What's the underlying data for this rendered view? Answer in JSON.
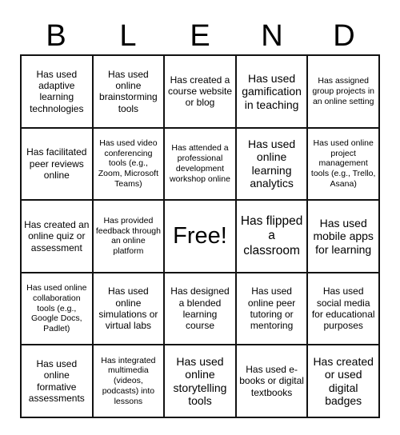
{
  "card": {
    "title_letters": [
      "B",
      "L",
      "E",
      "N",
      "D"
    ],
    "free_space_label": "Free!",
    "border_color": "#111111",
    "background_color": "#ffffff",
    "text_color": "#000000"
  },
  "grid": {
    "columns": 5,
    "rows": 5,
    "cells": [
      {
        "id": "b1",
        "text": "Has used adaptive learning technologies"
      },
      {
        "id": "l1",
        "text": "Has used online brainstorming tools"
      },
      {
        "id": "e1",
        "text": "Has created a course website or blog"
      },
      {
        "id": "n1",
        "text": "Has used gamification in teaching"
      },
      {
        "id": "d1",
        "text": "Has assigned group projects in an online setting"
      },
      {
        "id": "b2",
        "text": "Has facilitated peer reviews online"
      },
      {
        "id": "l2",
        "text": "Has used video conferencing tools (e.g., Zoom, Microsoft Teams)"
      },
      {
        "id": "e2",
        "text": "Has attended a professional development workshop online"
      },
      {
        "id": "n2",
        "text": "Has used online learning analytics"
      },
      {
        "id": "d2",
        "text": "Has used online project management tools (e.g., Trello, Asana)"
      },
      {
        "id": "b3",
        "text": "Has created an online quiz or assessment"
      },
      {
        "id": "l3",
        "text": "Has provided feedback through an online platform"
      },
      {
        "id": "e3",
        "text": "Free!"
      },
      {
        "id": "n3",
        "text": "Has flipped a classroom"
      },
      {
        "id": "d3",
        "text": "Has used mobile apps for learning"
      },
      {
        "id": "b4",
        "text": "Has used online collaboration tools (e.g., Google Docs, Padlet)"
      },
      {
        "id": "l4",
        "text": "Has used online simulations or virtual labs"
      },
      {
        "id": "e4",
        "text": "Has designed a blended learning course"
      },
      {
        "id": "n4",
        "text": "Has used online peer tutoring or mentoring"
      },
      {
        "id": "d4",
        "text": "Has used social media for educational purposes"
      },
      {
        "id": "b5",
        "text": "Has used online formative assessments"
      },
      {
        "id": "l5",
        "text": "Has integrated multimedia (videos, podcasts) into lessons"
      },
      {
        "id": "e5",
        "text": "Has used online storytelling tools"
      },
      {
        "id": "n5",
        "text": "Has used e-books or digital textbooks"
      },
      {
        "id": "d5",
        "text": "Has created or used digital badges"
      }
    ]
  }
}
